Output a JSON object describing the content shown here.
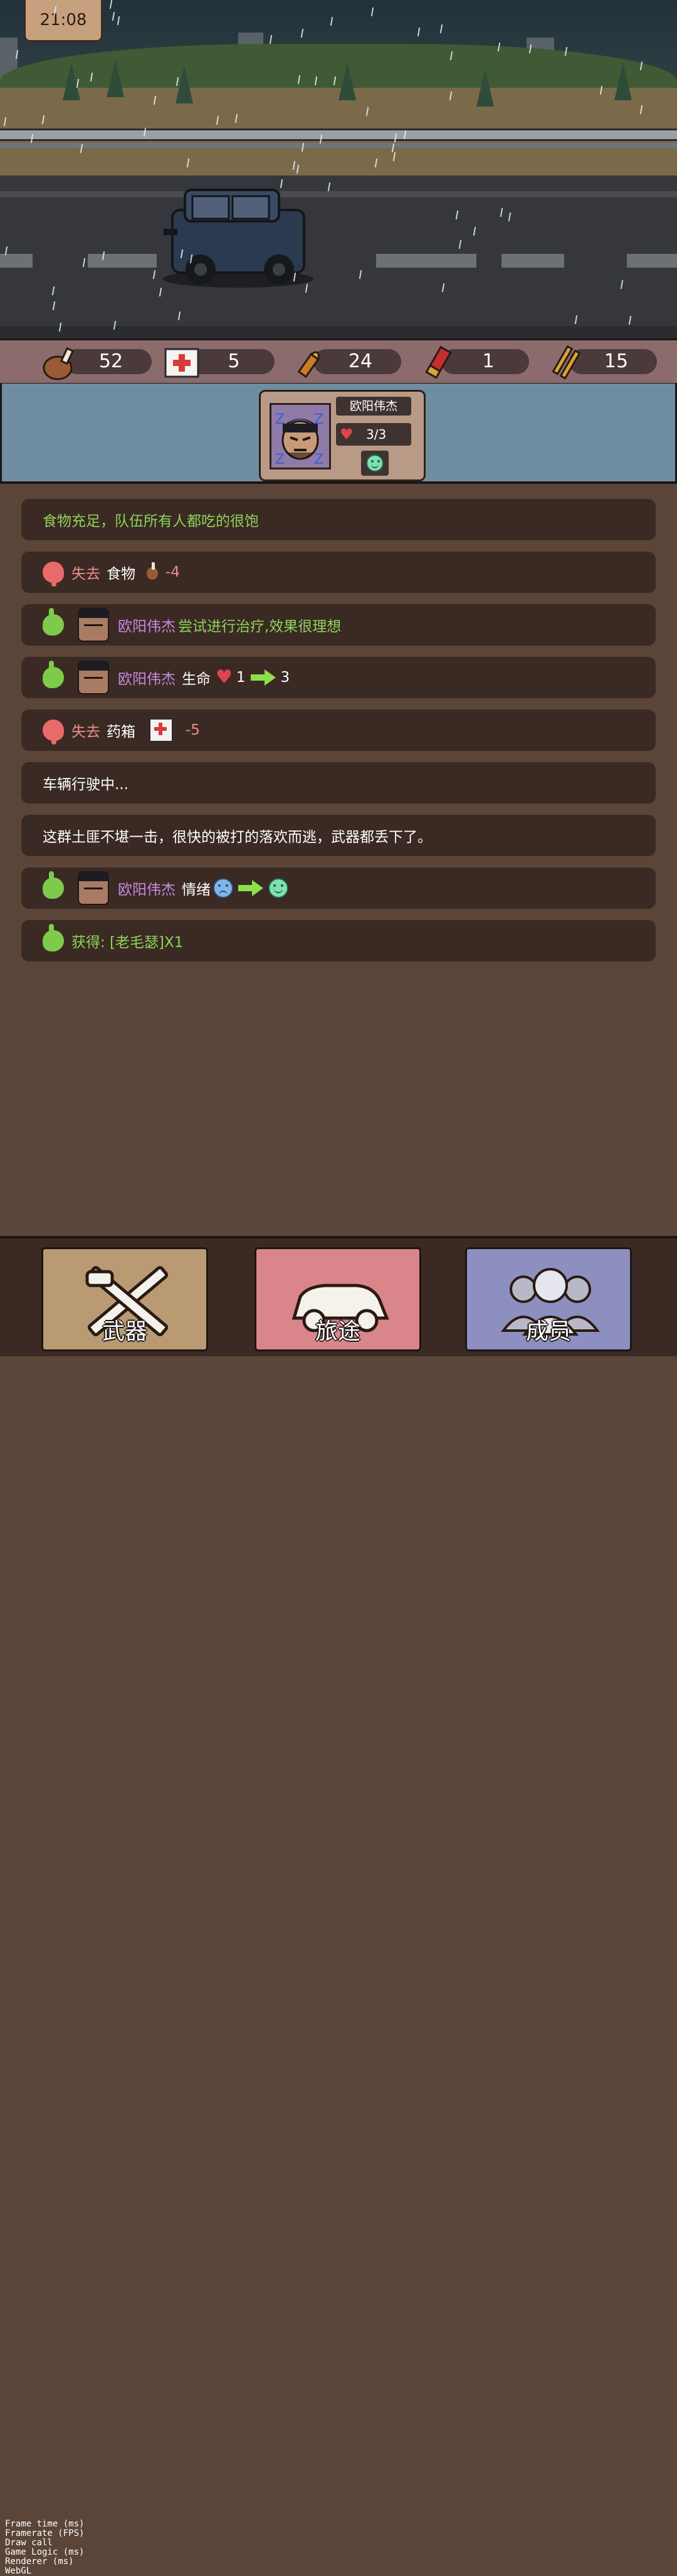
{
  "clock": {
    "time": "21:08"
  },
  "resources": [
    {
      "icon": "meat-icon",
      "value": "52"
    },
    {
      "icon": "medkit-icon",
      "value": "5"
    },
    {
      "icon": "bullet-icon",
      "value": "24"
    },
    {
      "icon": "shotgun-shell-icon",
      "value": "1"
    },
    {
      "icon": "rifle-ammo-icon",
      "value": "15"
    }
  ],
  "party": {
    "member": {
      "name": "欧阳伟杰",
      "hp": "3/3",
      "mood": "happy"
    }
  },
  "log": [
    {
      "text": "食物充足，队伍所有人都吃的很饱"
    },
    {
      "verb": "失去",
      "item": "食物",
      "delta": "-4"
    },
    {
      "name": "欧阳伟杰",
      "text": "尝试进行治疗,效果很理想"
    },
    {
      "name": "欧阳伟杰",
      "label": "生命",
      "from": "1",
      "to": "3"
    },
    {
      "verb": "失去",
      "item": "药箱",
      "delta": "-5"
    },
    {
      "text": "车辆行驶中..."
    },
    {
      "text": "这群土匪不堪一击，很快的被打的落欢而逃，武器都丢下了。"
    },
    {
      "name": "欧阳伟杰",
      "label": "情绪"
    },
    {
      "text": "获得: [老毛瑟]X1"
    }
  ],
  "nav": {
    "weapons": "武器",
    "journey": "旅途",
    "members": "成员"
  },
  "debug": {
    "lines": [
      "Frame time (ms)",
      "Framerate (FPS)",
      "Draw call",
      "Game Logic (ms)",
      "Renderer (ms)",
      "WebGL"
    ]
  },
  "colors": {
    "positive": "#8ed25a",
    "negative": "#ef8d8d",
    "name": "#c889e0",
    "log_bg": "#3a2a23"
  }
}
